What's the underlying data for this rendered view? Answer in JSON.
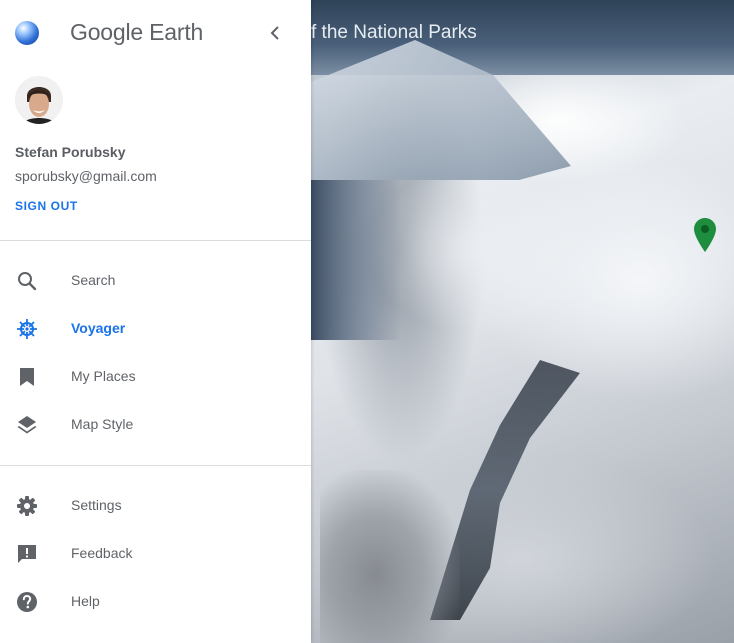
{
  "app": {
    "name": "Google Earth",
    "collapse_icon": "chevron-left-icon"
  },
  "map": {
    "title_fragment": "f the National Parks",
    "marker_color": "#1e8e3e"
  },
  "user": {
    "name": "Stefan Porubsky",
    "email": "sporubsky@gmail.com",
    "sign_out": "SIGN OUT"
  },
  "nav": {
    "primary": [
      {
        "label": "Search",
        "icon": "search-icon",
        "active": false
      },
      {
        "label": "Voyager",
        "icon": "voyager-wheel-icon",
        "active": true
      },
      {
        "label": "My Places",
        "icon": "bookmark-icon",
        "active": false
      },
      {
        "label": "Map Style",
        "icon": "layers-icon",
        "active": false
      }
    ],
    "secondary": [
      {
        "label": "Settings",
        "icon": "gear-icon"
      },
      {
        "label": "Feedback",
        "icon": "feedback-icon"
      },
      {
        "label": "Help",
        "icon": "help-icon"
      }
    ]
  },
  "colors": {
    "accent": "#1a73e8",
    "icon_default": "#5f6368"
  }
}
